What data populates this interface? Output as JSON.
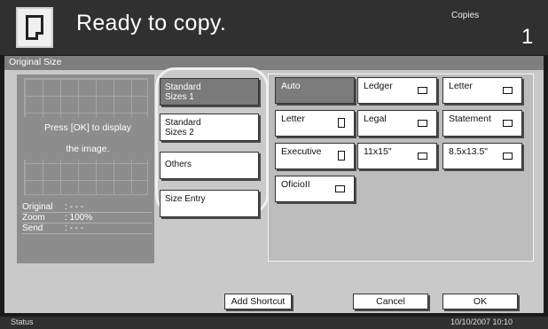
{
  "header": {
    "message": "Ready to copy.",
    "copies_label": "Copies",
    "copies_value": "1"
  },
  "screen": {
    "title": "Original Size"
  },
  "preview": {
    "message_line1": "Press [OK] to display",
    "message_line2": "the image.",
    "info": [
      {
        "key": "Original",
        "value": ": - - -"
      },
      {
        "key": "Zoom",
        "value": ": 100%"
      },
      {
        "key": "Send",
        "value": ": - - -"
      }
    ]
  },
  "categories": {
    "standard1_line1": "Standard",
    "standard1_line2": "Sizes 1",
    "standard2_line1": "Standard",
    "standard2_line2": "Sizes 2",
    "others": "Others",
    "size_entry": "Size Entry",
    "selected": "Standard Sizes 1"
  },
  "sizes": {
    "auto": "Auto",
    "ledger": "Ledger",
    "letter_landscape": "Letter",
    "letter_portrait": "Letter",
    "legal": "Legal",
    "statement": "Statement",
    "executive": "Executive",
    "s11x15": "11x15\"",
    "s85x135": "8.5x13.5\"",
    "oficio2": "OficioII",
    "selected": "Auto",
    "icons": {
      "landscape": "landscape-page-icon",
      "portrait": "portrait-page-icon"
    }
  },
  "footer": {
    "add_shortcut": "Add Shortcut",
    "cancel": "Cancel",
    "ok": "OK",
    "status": "Status",
    "datetime": "10/10/2007   10:10"
  },
  "colors": {
    "header_bg": "#303030",
    "panel_bg": "#c9c9c9",
    "selected_bg": "#7a7a7a",
    "highlight_outline": "#efefef"
  }
}
